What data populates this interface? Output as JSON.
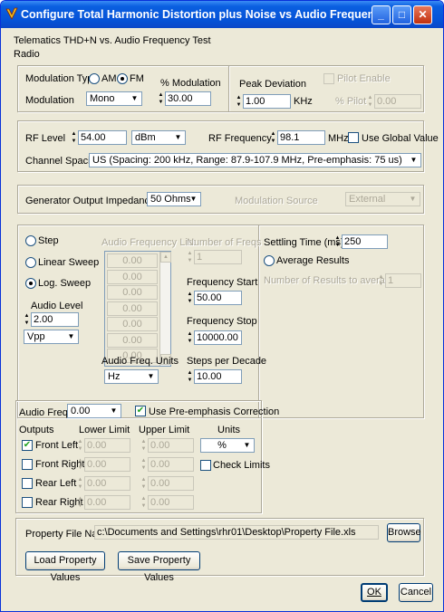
{
  "window": {
    "title": "Configure Total Harmonic Distortion plus Noise vs Audio Frequency Test Param...",
    "minimize_icon": "minimize-icon",
    "maximize_icon": "maximize-icon",
    "close_icon": "close-icon",
    "titlebar_color": "#0553d8"
  },
  "header": {
    "test_name": "Telematics THD+N vs. Audio Frequency Test",
    "subtitle": "Radio"
  },
  "modulation": {
    "type_label": "Modulation Type",
    "am_label": "AM",
    "fm_label": "FM",
    "selected_type": "FM",
    "modulation_label": "Modulation",
    "modulation_value": "Mono",
    "pct_label": "% Modulation",
    "pct_value": "30.00",
    "peak_label": "Peak Deviation",
    "peak_value": "1.00",
    "peak_unit": "KHz",
    "pilot_enable_label": "Pilot Enable",
    "pilot_pct_label": "% Pilot",
    "pilot_pct_value": "0.00"
  },
  "rf": {
    "level_label": "RF Level",
    "level_value": "54.00",
    "level_unit": "dBm",
    "freq_label": "RF Frequency",
    "freq_value": "98.1",
    "freq_unit": "MHz",
    "global_label": "Use Global Value",
    "spacing_label": "Channel Spacing",
    "spacing_value": "US (Spacing: 200 kHz, Range: 87.9-107.9 MHz, Pre-emphasis: 75 us)"
  },
  "generator": {
    "impedance_label": "Generator Output Impedance",
    "impedance_value": "50 Ohms",
    "mod_source_label": "Modulation Source",
    "mod_source_value": "External"
  },
  "sweep": {
    "step_label": "Step",
    "linear_label": "Linear Sweep",
    "log_label": "Log. Sweep",
    "selected": "Log. Sweep",
    "audio_level_label": "Audio Level",
    "audio_level_value": "2.00",
    "audio_level_unit": "Vpp",
    "freq_list_label": "Audio Frequency List",
    "freq_list": [
      "0.00",
      "0.00",
      "0.00",
      "0.00",
      "0.00",
      "0.00",
      "0.00"
    ],
    "num_freqs_label": "Number of Freqs",
    "num_freqs_value": "1",
    "freq_start_label": "Frequency  Start",
    "freq_start_value": "50.00",
    "freq_stop_label": "Frequency Stop",
    "freq_stop_value": "10000.00",
    "units_label": "Audio Freq. Units",
    "units_value": "Hz",
    "steps_label": "Steps per Decade",
    "steps_value": "10.00"
  },
  "settling": {
    "time_label": "Settling Time (ms)",
    "time_value": "250",
    "average_label": "Average Results",
    "num_avg_label": "Number of Results to average",
    "num_avg_value": "1"
  },
  "limits": {
    "audio_freq_label": "Audio Freq.",
    "audio_freq_value": "0.00",
    "preemph_label": "Use Pre-emphasis Correction",
    "outputs_label": "Outputs",
    "lower_label": "Lower Limit",
    "upper_label": "Upper Limit",
    "units_label": "Units",
    "units_value": "%",
    "check_limits_label": "Check Limits",
    "rows": [
      {
        "label": "Front Left",
        "checked": true,
        "lower": "0.00",
        "upper": "0.00"
      },
      {
        "label": "Front Right",
        "checked": false,
        "lower": "0.00",
        "upper": "0.00"
      },
      {
        "label": "Rear Left",
        "checked": false,
        "lower": "0.00",
        "upper": "0.00"
      },
      {
        "label": "Rear Right",
        "checked": false,
        "lower": "0.00",
        "upper": "0.00"
      }
    ]
  },
  "file": {
    "property_label": "Property File Name",
    "property_value": "c:\\Documents and Settings\\rhr01\\Desktop\\Property File.xls",
    "browse_label": "Browse",
    "load_label": "Load Property Values",
    "save_label": "Save Property Values"
  },
  "footer": {
    "ok_label": "OK",
    "cancel_label": "Cancel"
  }
}
